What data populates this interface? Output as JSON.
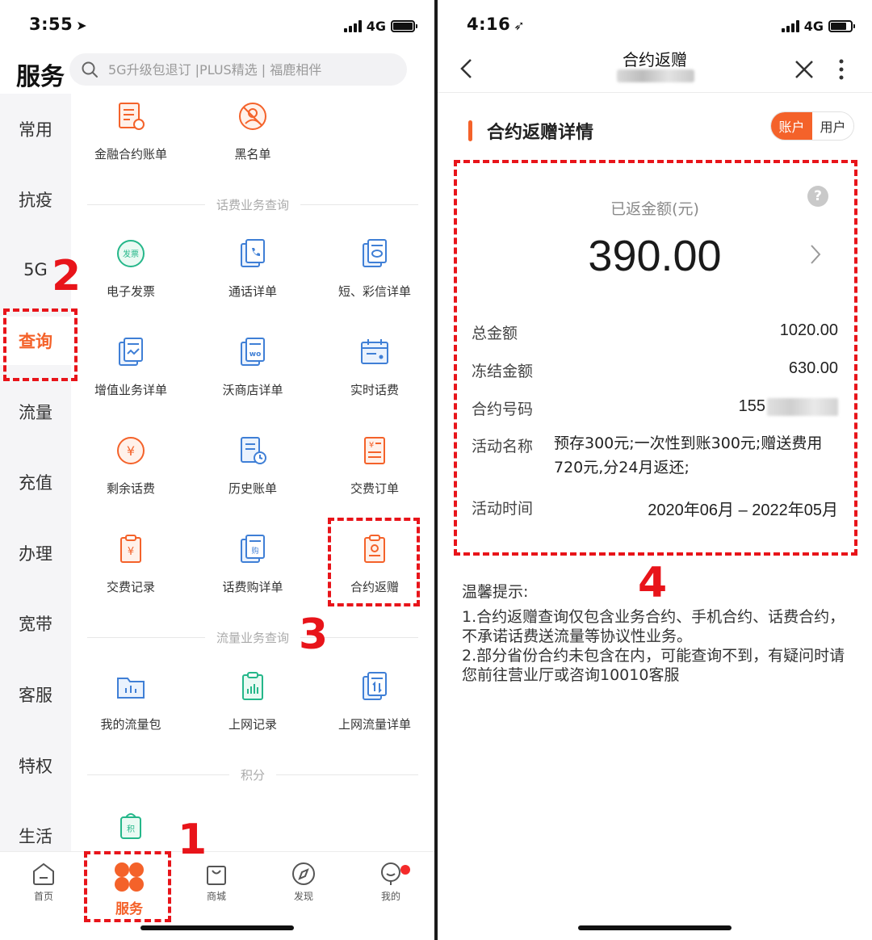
{
  "left": {
    "status": {
      "time": "3:55",
      "network": "4G"
    },
    "header": {
      "title": "服务",
      "search_placeholder": "5G升级包退订 |PLUS精选 | 福鹿相伴"
    },
    "sidebar": [
      "常用",
      "抗疫",
      "5G",
      "查询",
      "流量",
      "充值",
      "办理",
      "宽带",
      "客服",
      "特权",
      "生活"
    ],
    "sidebar_active": "查询",
    "top_tiles": [
      "金融合约账单",
      "黑名单"
    ],
    "sections": {
      "huafei": {
        "title": "话费业务查询",
        "tiles": [
          "电子发票",
          "通话详单",
          "短、彩信详单",
          "增值业务详单",
          "沃商店详单",
          "实时话费",
          "剩余话费",
          "历史账单",
          "交费订单",
          "交费记录",
          "话费购详单",
          "合约返赠"
        ]
      },
      "liuliang": {
        "title": "流量业务查询",
        "tiles": [
          "我的流量包",
          "上网记录",
          "上网流量详单"
        ]
      },
      "jifen": {
        "title": "积分"
      }
    },
    "icon_glyphs": {
      "fapiao": "发票",
      "wo": "wo",
      "yen": "¥",
      "gou": "购",
      "ji": "积"
    },
    "tabbar": [
      "首页",
      "服务",
      "商城",
      "发现",
      "我的"
    ]
  },
  "right": {
    "status": {
      "time": "4:16",
      "network": "4G"
    },
    "nav": {
      "title": "合约返赠"
    },
    "detail": {
      "heading": "合约返赠详情",
      "seg_account": "账户",
      "seg_user": "用户",
      "amount_label": "已返金额(元)",
      "amount": "390.00",
      "help": "?",
      "rows": {
        "total": {
          "label": "总金额",
          "value": "1020.00"
        },
        "frozen": {
          "label": "冻结金额",
          "value": "630.00"
        },
        "contract": {
          "label": "合约号码",
          "value": "155"
        },
        "activity": {
          "label": "活动名称",
          "value": "预存300元;一次性到账300元;赠送费用720元,分24月返还;"
        },
        "period": {
          "label": "活动时间",
          "value": "2020年06月 – 2022年05月"
        }
      }
    },
    "tips": {
      "title": "温馨提示:",
      "line1": "1.合约返赠查询仅包含业务合约、手机合约、话费合约，不承诺话费送流量等协议性业务。",
      "line2": "2.部分省份合约未包含在内，可能查询不到，有疑问时请您前往营业厅或咨询10010客服"
    }
  },
  "annotations": [
    "1",
    "2",
    "3",
    "4"
  ],
  "colors": {
    "accent": "#f4622a",
    "annotation": "#e8141a",
    "icon_blue": "#3f7fd6",
    "icon_green": "#25b78a"
  }
}
